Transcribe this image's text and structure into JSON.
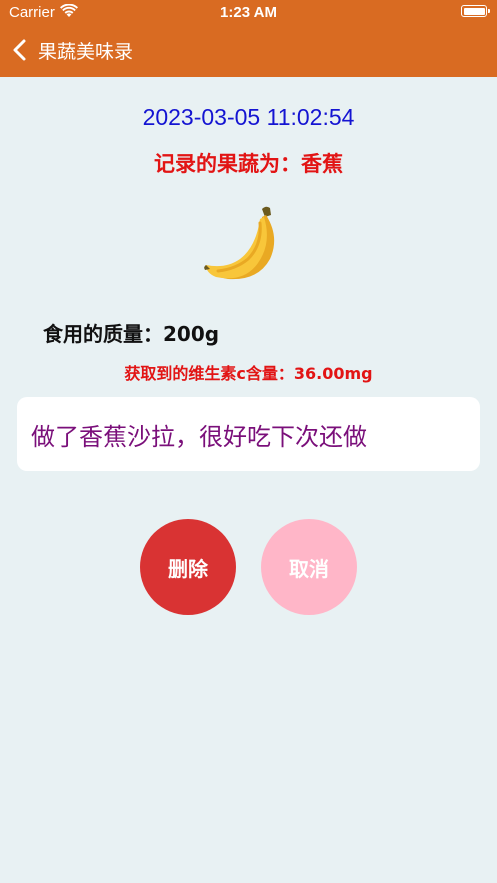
{
  "status_bar": {
    "carrier": "Carrier",
    "time": "1:23 AM",
    "icons": [
      "wifi-icon",
      "battery-icon"
    ]
  },
  "nav": {
    "back_icon": "chevron-left-icon",
    "title": "果蔬美味录",
    "bar_color": "#d96b22"
  },
  "record": {
    "datetime": "2023-03-05 11:02:54",
    "fruit_line": "记录的果蔬为：香蕉",
    "fruit_icon": "banana-icon",
    "weight_line": "食用的质量：200g",
    "vitamin_line": "获取到的维生素c含量：36.00mg",
    "note": "做了香蕉沙拉，很好吃下次还做"
  },
  "actions": {
    "delete_label": "删除",
    "cancel_label": "取消",
    "delete_color": "#d93333",
    "cancel_color": "#ffb6c8"
  },
  "colors": {
    "background": "#e8f1f3",
    "datetime": "#1414d2",
    "highlight_red": "#e21414",
    "note_text": "#7a0f7a"
  }
}
